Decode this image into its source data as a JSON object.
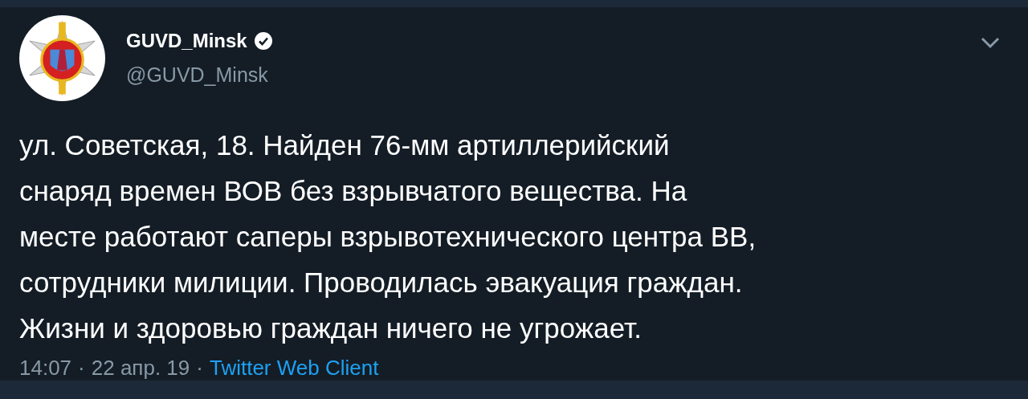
{
  "tweet": {
    "author": {
      "name": "GUVD_Minsk",
      "verified": true,
      "handle": "@GUVD_Minsk"
    },
    "text": "ул. Советская, 18. Найден 76-мм артиллерийский\nснаряд времен ВОВ без взрывчатого вещества. На\nместе работают саперы взрывотехнического центра ВВ,\nсотрудники милиции. Проводилась эвакуация граждан.\nЖизни и здоровью граждан ничего не угрожает.",
    "time": "14:07",
    "separator_1": "·",
    "date": "22 апр. 19",
    "separator_2": "·",
    "source": "Twitter Web Client"
  }
}
